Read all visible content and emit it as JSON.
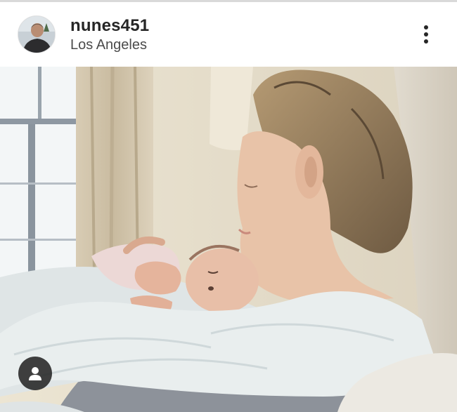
{
  "post": {
    "username": "nunes451",
    "location": "Los Angeles"
  },
  "icons": {
    "avatar": "avatar",
    "more": "more-options-vertical-icon",
    "user_tag": "person-icon"
  },
  "colors": {
    "text_primary": "#262626",
    "text_secondary": "#4b4b4b",
    "tag_button_bg": "#262626"
  }
}
